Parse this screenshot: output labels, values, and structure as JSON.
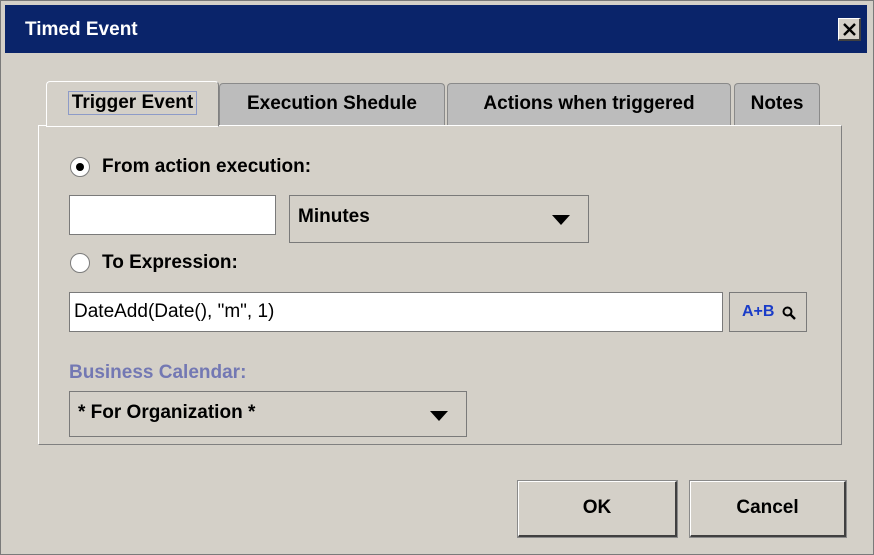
{
  "window": {
    "title": "Timed Event"
  },
  "tabs": [
    {
      "label": "Trigger Event",
      "active": true
    },
    {
      "label": "Execution Shedule",
      "active": false
    },
    {
      "label": "Actions when triggered",
      "active": false
    },
    {
      "label": "Notes",
      "active": false
    }
  ],
  "trigger": {
    "from_action_label": "From action execution:",
    "from_action_selected": true,
    "offset_value": "",
    "unit_selected": "Minutes",
    "to_expression_label": "To Expression:",
    "to_expression_selected": false,
    "expression_value": "DateAdd(Date(), \"m\", 1)",
    "expression_builder_label": "A+B",
    "calendar_label": "Business Calendar:",
    "calendar_selected": "* For Organization *"
  },
  "buttons": {
    "ok": "OK",
    "cancel": "Cancel"
  },
  "colors": {
    "title_bar": "#0a246a",
    "dialog_bg": "#d4d0c8",
    "calendar_label": "#7378b3",
    "builder_text": "#1a3cc8"
  },
  "icons": {
    "close": "close-icon",
    "dropdown": "chevron-down-icon",
    "builder_magnifier": "magnifier-icon"
  }
}
